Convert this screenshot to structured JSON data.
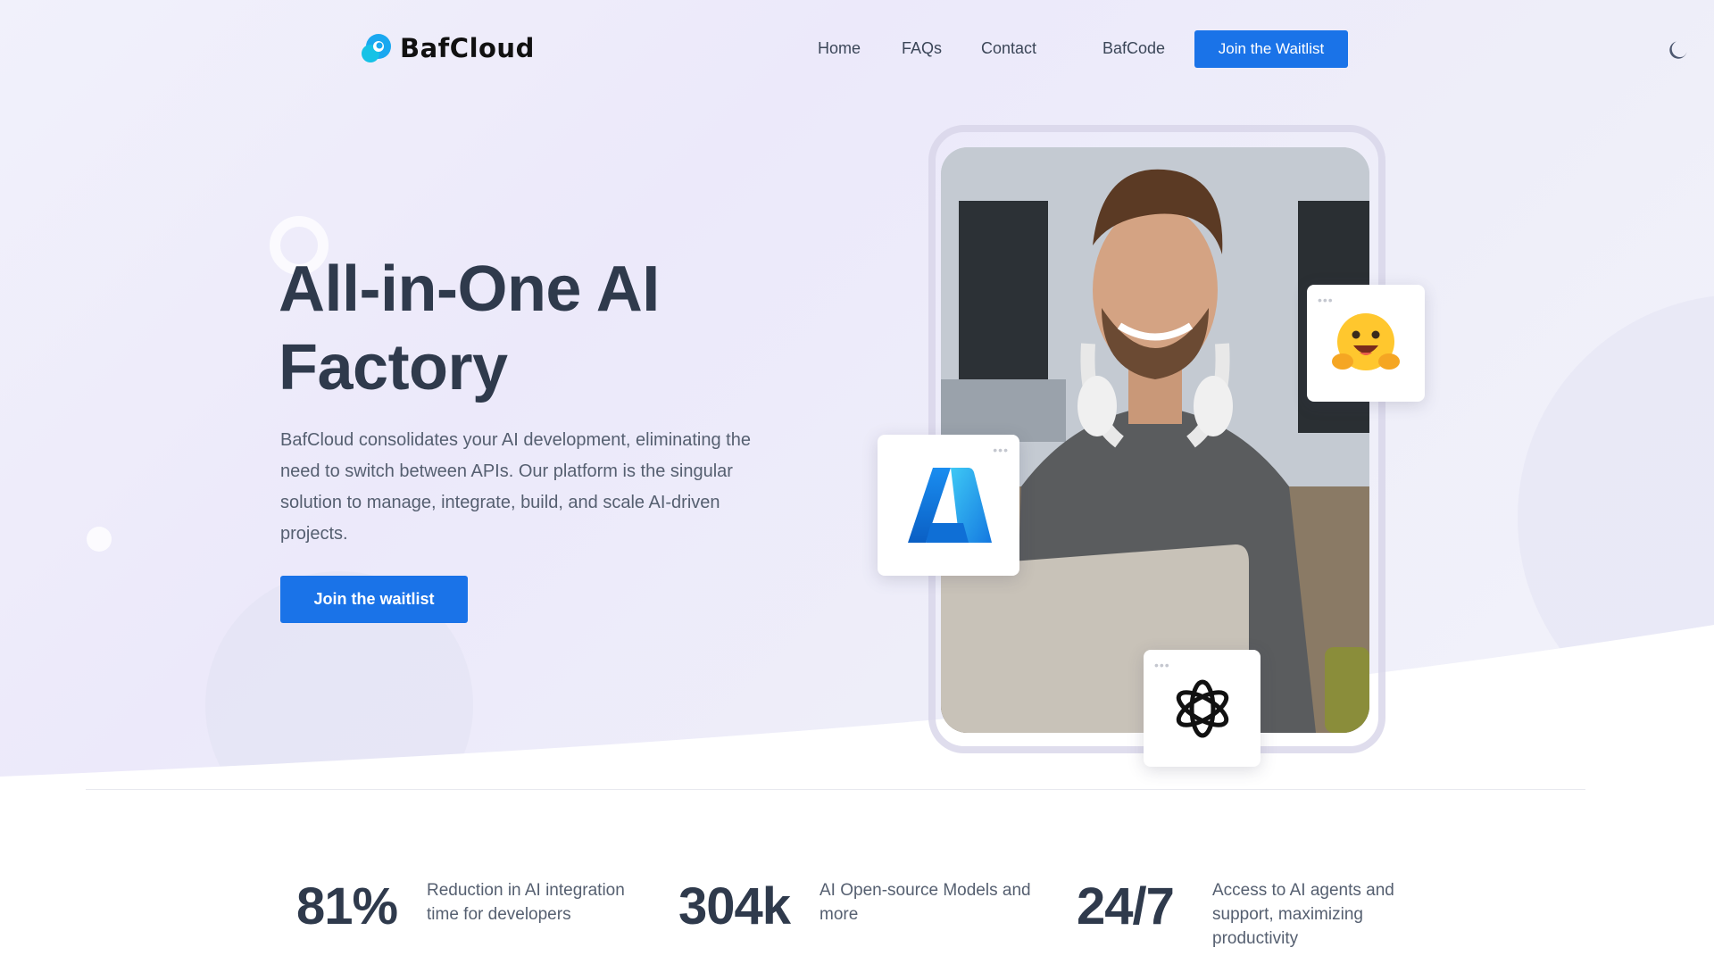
{
  "header": {
    "logo_text": "BafCloud",
    "nav": [
      "Home",
      "FAQs",
      "Contact",
      "BafCode"
    ],
    "waitlist_label": "Join the Waitlist",
    "theme_toggle_icon": "moon-icon"
  },
  "hero": {
    "title_line1": "All-in-One AI",
    "title_line2": "Factory",
    "description": "BafCloud consolidates your AI development, eliminating the need to switch between APIs. Our platform is the singular solution to manage, integrate, build, and scale AI-driven projects.",
    "cta_label": "Join the waitlist",
    "cards": [
      "azure-logo-icon",
      "hugging-face-icon",
      "openai-logo-icon"
    ],
    "card_dots": "•••"
  },
  "stats": [
    {
      "value": "81%",
      "label": "Reduction in AI integration time for developers"
    },
    {
      "value": "304k",
      "label": "AI Open-source Models and more"
    },
    {
      "value": "24/7",
      "label": "Access to AI agents and support, maximizing productivity"
    }
  ],
  "colors": {
    "accent": "#1a73e8",
    "heading": "#2f3a4c",
    "body_text": "#555f70"
  }
}
